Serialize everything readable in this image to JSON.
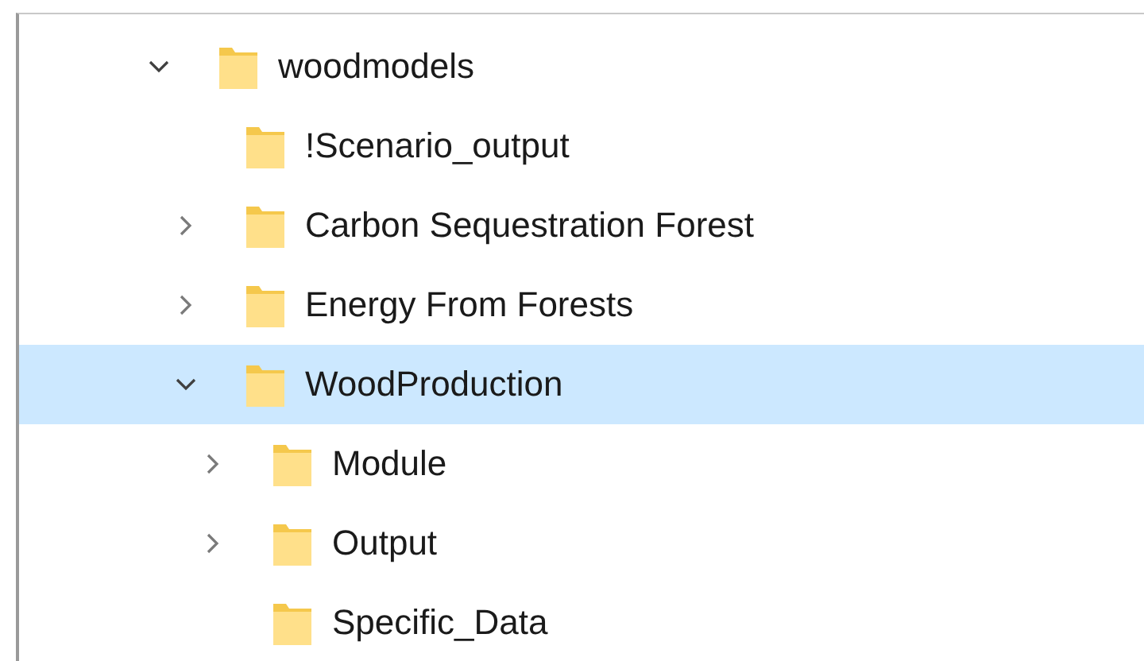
{
  "tree": [
    {
      "label": "woodmodels",
      "kind": "expandable",
      "expanded": true,
      "selected": false,
      "children": [
        {
          "label": "!Scenario_output",
          "kind": "plain",
          "selected": false
        },
        {
          "label": "Carbon Sequestration Forest",
          "kind": "expandable",
          "expanded": false,
          "selected": false
        },
        {
          "label": "Energy From Forests",
          "kind": "expandable",
          "expanded": false,
          "selected": false
        },
        {
          "label": "WoodProduction",
          "kind": "expandable",
          "expanded": true,
          "selected": true,
          "children": [
            {
              "label": "Module",
              "kind": "expandable",
              "expanded": false,
              "selected": false
            },
            {
              "label": "Output",
              "kind": "expandable",
              "expanded": false,
              "selected": false
            },
            {
              "label": "Specific_Data",
              "kind": "plain",
              "selected": false
            }
          ]
        }
      ]
    }
  ]
}
